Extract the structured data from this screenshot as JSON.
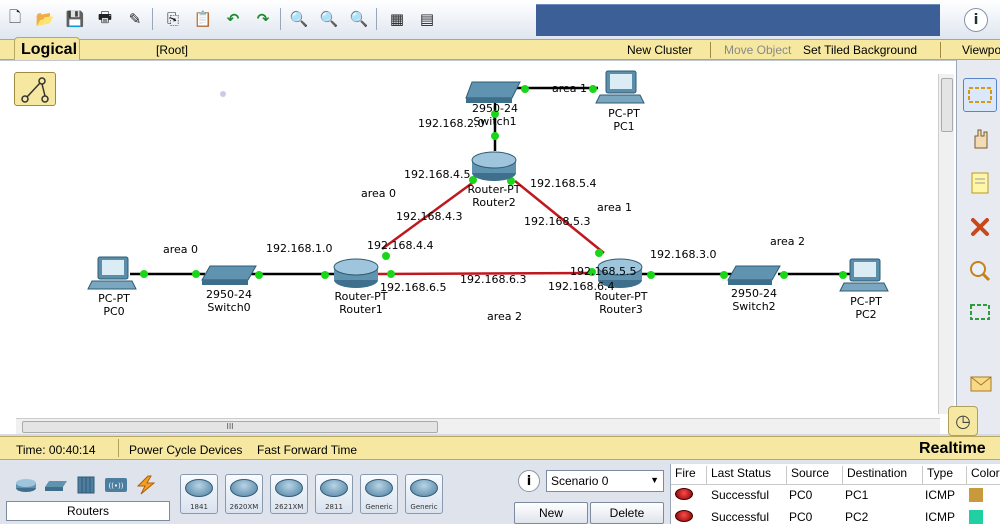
{
  "toolbar": {
    "buttons": [
      {
        "name": "new-file-icon",
        "glyph": "🗋"
      },
      {
        "name": "open-folder-icon",
        "glyph": "📂"
      },
      {
        "name": "save-icon",
        "glyph": "💾"
      },
      {
        "name": "print-icon",
        "glyph": "🖶"
      },
      {
        "name": "activity-wizard-icon",
        "glyph": "✎"
      },
      {
        "name": "copy-icon",
        "glyph": "⎘"
      },
      {
        "name": "paste-icon",
        "glyph": "📋"
      },
      {
        "name": "undo-icon",
        "glyph": "↶"
      },
      {
        "name": "redo-icon",
        "glyph": "↷"
      },
      {
        "name": "zoom-in-icon",
        "glyph": "🔍"
      },
      {
        "name": "zoom-reset-icon",
        "glyph": "🔍"
      },
      {
        "name": "zoom-out-icon",
        "glyph": "🔍"
      },
      {
        "name": "palette-icon",
        "glyph": "▦"
      },
      {
        "name": "custom-device-icon",
        "glyph": "▤"
      }
    ],
    "info_glyph": "i"
  },
  "workspace": {
    "title": "Logical",
    "root": "[Root]",
    "new_cluster": "New Cluster",
    "move_object": "Move Object",
    "set_tiled_background": "Set Tiled Background",
    "viewport": "Viewport"
  },
  "topology": {
    "devices": {
      "switch1": {
        "model": "2950-24",
        "name": "Switch1"
      },
      "pc1": {
        "model": "PC-PT",
        "name": "PC1"
      },
      "router2": {
        "model": "Router-PT",
        "name": "Router2"
      },
      "router1": {
        "model": "Router-PT",
        "name": "Router1"
      },
      "router3": {
        "model": "Router-PT",
        "name": "Router3"
      },
      "pc0": {
        "model": "PC-PT",
        "name": "PC0"
      },
      "switch0": {
        "model": "2950-24",
        "name": "Switch0"
      },
      "switch2": {
        "model": "2950-24",
        "name": "Switch2"
      },
      "pc2": {
        "model": "PC-PT",
        "name": "PC2"
      }
    },
    "labels": {
      "area1_top": "area 1",
      "net_192_168_2_0": "192.168.2.0",
      "ip_192_168_4_5": "192.168.4.5",
      "ip_192_168_5_4": "192.168.5.4",
      "area0_mid": "area 0",
      "area1_right": "area 1",
      "ip_192_168_4_3": "192.168.4.3",
      "ip_192_168_5_3": "192.168.5.3",
      "area0_left": "area 0",
      "net_192_168_1_0": "192.168.1.0",
      "ip_192_168_4_4": "192.168.4.4",
      "ip_192_168_5_5": "192.168.5.5",
      "net_192_168_3_0": "192.168.3.0",
      "area2_right": "area 2",
      "ip_192_168_6_5": "192.168.6.5",
      "net_192_168_6_3": "192.168.6.3",
      "ip_192_168_6_4": "192.168.6.4",
      "area2_bottom": "area 2"
    }
  },
  "scrollbar": {
    "thumb_grip": "III"
  },
  "status": {
    "time": "Time: 00:40:14",
    "power_cycle": "Power Cycle Devices",
    "fast_forward": "Fast Forward Time",
    "mode": "Realtime"
  },
  "device_panel": {
    "category_label": "Routers",
    "categories": [
      "routers-category-icon",
      "switches-category-icon",
      "hubs-category-icon",
      "wireless-category-icon",
      "connections-category-icon"
    ],
    "models": [
      "1841",
      "2620XM",
      "2621XM",
      "2811",
      "Generic",
      "Generic"
    ]
  },
  "scenario": {
    "info_glyph": "i",
    "selected": "Scenario 0",
    "new_label": "New",
    "delete_label": "Delete"
  },
  "pdu_list": {
    "headers": [
      "Fire",
      "Last Status",
      "Source",
      "Destination",
      "Type",
      "Color"
    ],
    "rows": [
      {
        "status": "Successful",
        "source": "PC0",
        "destination": "PC1",
        "type": "ICMP",
        "color": "#c89a3c"
      },
      {
        "status": "Successful",
        "source": "PC0",
        "destination": "PC2",
        "type": "ICMP",
        "color": "#20d0a0"
      }
    ]
  }
}
